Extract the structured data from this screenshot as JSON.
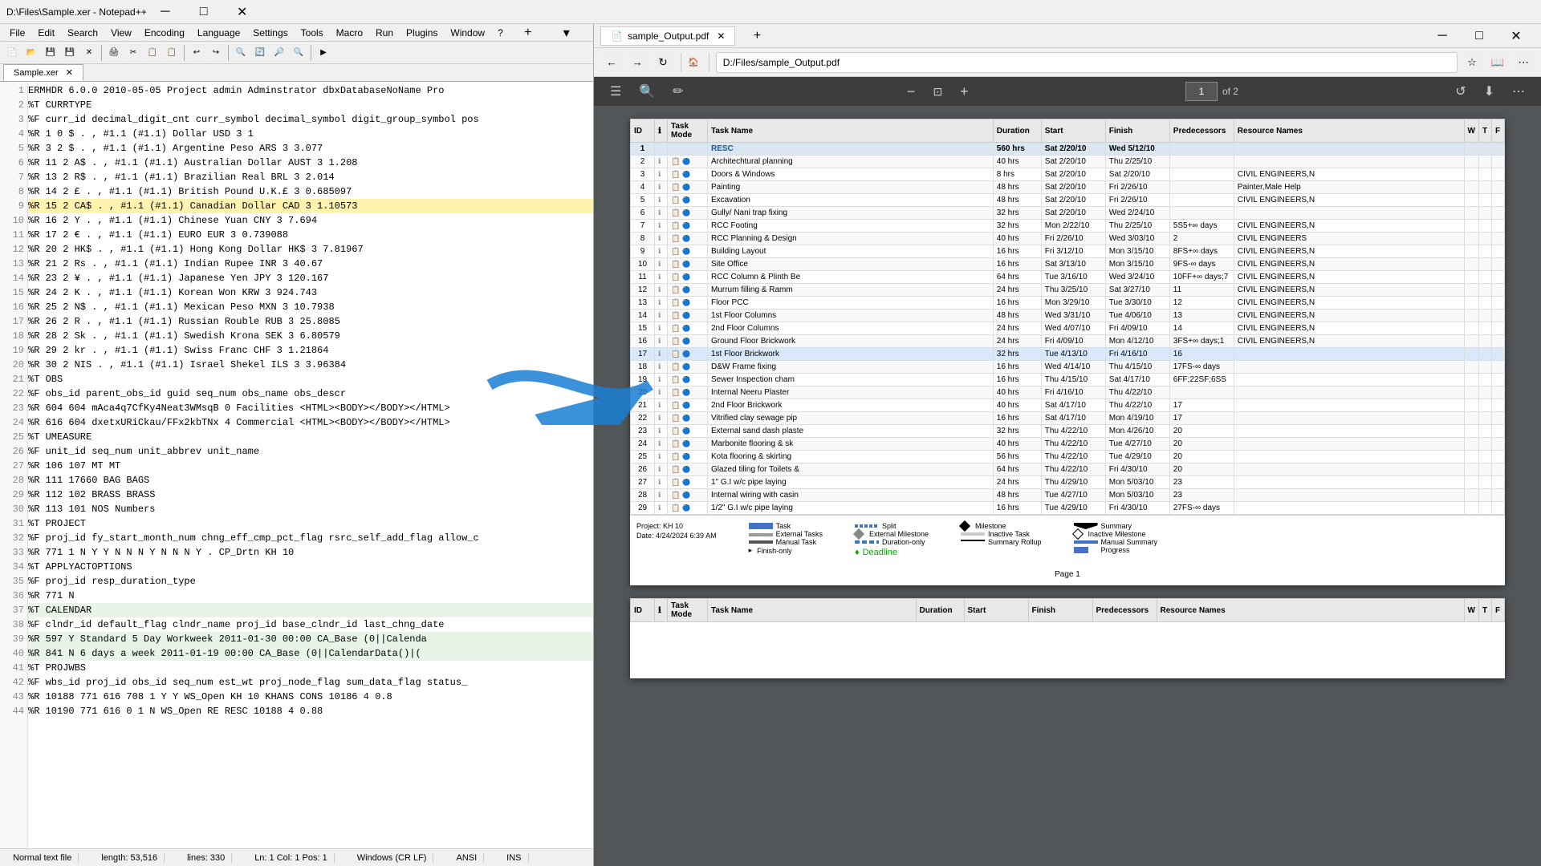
{
  "notepad": {
    "title": "D:\\Files\\Sample.xer - Notepad++",
    "filename": "Sample.xer",
    "menubar": [
      "File",
      "Edit",
      "Search",
      "View",
      "Encoding",
      "Language",
      "Settings",
      "Tools",
      "Macro",
      "Run",
      "Plugins",
      "Window",
      "?"
    ],
    "statusbar": {
      "mode": "Normal text file",
      "length": "length: 53,516",
      "lines": "lines: 330",
      "position": "Ln: 1   Col: 1   Pos: 1",
      "endings": "Windows (CR LF)",
      "encoding": "ANSI",
      "ins": "INS"
    },
    "lines": [
      {
        "num": 1,
        "text": "ERMHDR   6.0.0    2010-05-05  Project admin   Adminstrator    dbxDatabaseNoName    Pro"
      },
      {
        "num": 2,
        "text": "%T  CURRTYPE"
      },
      {
        "num": 3,
        "text": "%F  curr_id decimal_digit_cnt    curr_symbol decimal_symbol  digit_group_symbol  pos"
      },
      {
        "num": 4,
        "text": "%R  1   0   $   .   ,   #1.1    (#1.1)  Dollar  USD 3   1"
      },
      {
        "num": 5,
        "text": "%R  3   2   $   .   ,   #1.1    (#1.1)  Argentine Peso  ARS 3   3.077"
      },
      {
        "num": 6,
        "text": "%R  11  2   A$  .   ,   #1.1    (#1.1)  Australian Dollar   AUST    3   1.208"
      },
      {
        "num": 7,
        "text": "%R  13  2   R$  .   ,   #1.1    (#1.1)  Brazilian Real  BRL 3   2.014"
      },
      {
        "num": 8,
        "text": "%R  14  2   £   .   ,   #1.1    (#1.1)  British Pound   U.K.£   3   0.685097"
      },
      {
        "num": 9,
        "text": "%R  15  2   CA$ .   ,   #1.1    (#1.1)  Canadian Dollar CAD 3   1.10573"
      },
      {
        "num": 10,
        "text": "%R  16  2   Y   .   ,   #1.1    (#1.1)  Chinese Yuan    CNY 3   7.694"
      },
      {
        "num": 11,
        "text": "%R  17  2   €   .   ,   #1.1    (#1.1)  EURO    EUR 3   0.739088"
      },
      {
        "num": 12,
        "text": "%R  20  2   HK$ .   ,   #1.1    (#1.1)  Hong Kong Dollar    HK$ 3   7.81967"
      },
      {
        "num": 13,
        "text": "%R  21  2   Rs  .   ,   #1.1    (#1.1)  Indian Rupee    INR 3   40.67"
      },
      {
        "num": 14,
        "text": "%R  23  2   ¥   .   ,   #1.1    (#1.1)  Japanese Yen    JPY 3   120.167"
      },
      {
        "num": 15,
        "text": "%R  24  2   K   .   ,   #1.1    (#1.1)  Korean Won  KRW 3   924.743"
      },
      {
        "num": 16,
        "text": "%R  25  2   N$  .   ,   #1.1    (#1.1)  Mexican Peso    MXN 3   10.7938"
      },
      {
        "num": 17,
        "text": "%R  26  2   R   .   ,   #1.1    (#1.1)  Russian Rouble  RUB 3   25.8085"
      },
      {
        "num": 18,
        "text": "%R  28  2   Sk  .   ,   #1.1    (#1.1)  Swedish Krona   SEK 3   6.80579"
      },
      {
        "num": 19,
        "text": "%R  29  2   kr  .   ,   #1.1    (#1.1)  Swiss Franc CHF 3   1.21864"
      },
      {
        "num": 20,
        "text": "%R  30  2   NIS .   ,   #1.1    (#1.1)  Israel Shekel   ILS 3   3.96384"
      },
      {
        "num": 21,
        "text": "%T  OBS"
      },
      {
        "num": 22,
        "text": "%F  obs_id  parent_obs_id   guid    seq_num obs_name    obs_descr"
      },
      {
        "num": 23,
        "text": "%R  604 604 mAca4q7CfKy4Neat3WMsqB  0   Facilities  <HTML><BODY></BODY></HTML>"
      },
      {
        "num": 24,
        "text": "%R  616 604 dxetxURiCkau/FFx2kbTNx  4   Commercial  <HTML><BODY></BODY></HTML>"
      },
      {
        "num": 25,
        "text": "%T  UMEASURE"
      },
      {
        "num": 26,
        "text": "%F  unit_id seq_num unit_abbrev unit_name"
      },
      {
        "num": 27,
        "text": "%R  106 107 MT  MT"
      },
      {
        "num": 28,
        "text": "%R  111 17660   BAG BAGS"
      },
      {
        "num": 29,
        "text": "%R  112 102 BRASS   BRASS"
      },
      {
        "num": 30,
        "text": "%R  113 101 NOS Numbers"
      },
      {
        "num": 31,
        "text": "%T  PROJECT"
      },
      {
        "num": 32,
        "text": "%F  proj_id fy_start_month_num   chng_eff_cmp_pct_flag   rsrc_self_add_flag  allow_c"
      },
      {
        "num": 33,
        "text": "%R  771 1   N   Y   Y   N   N   N   Y   N   N   N   Y   .   CP_Drtn KH 10"
      },
      {
        "num": 34,
        "text": "%T  APPLYACTOPTIONS"
      },
      {
        "num": 35,
        "text": "%F  proj_id resp_duration_type"
      },
      {
        "num": 36,
        "text": "%R  771 N"
      },
      {
        "num": 37,
        "text": "%T  CALENDAR"
      },
      {
        "num": 38,
        "text": "%F  clndr_id    default_flag    clndr_name  proj_id base_clndr_id    last_chng_date"
      },
      {
        "num": 39,
        "text": "%R  597 Y   Standard 5 Day Workweek    2011-01-30 00:00    CA_Base (0||Calenda"
      },
      {
        "num": 40,
        "text": "%R  841 N   6 days a week   2011-01-19 00:00    CA_Base (0||CalendarData()|("
      },
      {
        "num": 41,
        "text": "%T  PROJWBS"
      },
      {
        "num": 42,
        "text": "%F  wbs_id  proj_id obs_id  seq_num est_wt  proj_node_flag  sum_data_flag   status_"
      },
      {
        "num": 43,
        "text": "%R  10188   771 616 708 1   Y   Y   WS_Open KH 10   KHANS CONS  10186   4   0.8"
      },
      {
        "num": 44,
        "text": "%R  10190   771 616 0   1   N   WS_Open RE  RESC    10188   4   0.88"
      }
    ]
  },
  "pdf_viewer": {
    "title": "sample_Output.pdf",
    "url": "D:/Files/sample_Output.pdf",
    "current_page": "1",
    "total_pages": "2",
    "toolbar": {
      "back": "←",
      "forward": "→",
      "refresh": "↻",
      "zoom_out": "−",
      "zoom_in": "+",
      "fit": "⊡",
      "more": "⋯"
    },
    "gantt": {
      "columns": [
        "ID",
        "",
        "Task Mode",
        "Task Name",
        "Duration",
        "Start",
        "Finish",
        "Predecessors",
        "Resource Names",
        "W",
        "T",
        "F"
      ],
      "rows": [
        {
          "id": 1,
          "mode": "",
          "name": "RESC",
          "duration": "560 hrs",
          "start": "Sat 2/20/10",
          "finish": "Wed 5/12/10",
          "pred": "",
          "resource": "",
          "bold": true
        },
        {
          "id": 2,
          "mode": "📋",
          "name": "Architechtural planning",
          "duration": "40 hrs",
          "start": "Sat 2/20/10",
          "finish": "Thu 2/25/10",
          "pred": "",
          "resource": ""
        },
        {
          "id": 3,
          "mode": "📋",
          "name": "Doors & Windows",
          "duration": "8 hrs",
          "start": "Sat 2/20/10",
          "finish": "Sat 2/20/10",
          "pred": "",
          "resource": "CIVIL ENGINEERS,N"
        },
        {
          "id": 4,
          "mode": "📋",
          "name": "Painting",
          "duration": "48 hrs",
          "start": "Sat 2/20/10",
          "finish": "Fri 2/26/10",
          "pred": "",
          "resource": "Painter,Male Help"
        },
        {
          "id": 5,
          "mode": "📋",
          "name": "Excavation",
          "duration": "48 hrs",
          "start": "Sat 2/20/10",
          "finish": "Fri 2/26/10",
          "pred": "",
          "resource": "CIVIL ENGINEERS,N"
        },
        {
          "id": 6,
          "mode": "📋",
          "name": "Gully/ Nani trap fixing",
          "duration": "32 hrs",
          "start": "Sat 2/20/10",
          "finish": "Wed 2/24/10",
          "pred": "",
          "resource": ""
        },
        {
          "id": 7,
          "mode": "📋",
          "name": "RCC Footing",
          "duration": "32 hrs",
          "start": "Mon 2/22/10",
          "finish": "Thu 2/25/10",
          "pred": "5S5+∞ days",
          "resource": "CIVIL ENGINEERS,N"
        },
        {
          "id": 8,
          "mode": "📋",
          "name": "RCC Planning & Design",
          "duration": "40 hrs",
          "start": "Fri 2/26/10",
          "finish": "Wed 3/03/10",
          "pred": "2",
          "resource": "CIVIL ENGINEERS"
        },
        {
          "id": 9,
          "mode": "📋",
          "name": "Building Layout",
          "duration": "16 hrs",
          "start": "Fri 3/12/10",
          "finish": "Mon 3/15/10",
          "pred": "8FS+∞ days",
          "resource": "CIVIL ENGINEERS,N"
        },
        {
          "id": 10,
          "mode": "📋",
          "name": "Site Office",
          "duration": "16 hrs",
          "start": "Sat 3/13/10",
          "finish": "Mon 3/15/10",
          "pred": "9FS-∞ days",
          "resource": "CIVIL ENGINEERS,N"
        },
        {
          "id": 11,
          "mode": "📋",
          "name": "RCC Column & Plinth Be",
          "duration": "64 hrs",
          "start": "Tue 3/16/10",
          "finish": "Wed 3/24/10",
          "pred": "10FF+∞ days;7",
          "resource": "CIVIL ENGINEERS,N"
        },
        {
          "id": 12,
          "mode": "📋",
          "name": "Murrum filling & Ramm",
          "duration": "24 hrs",
          "start": "Thu 3/25/10",
          "finish": "Sat 3/27/10",
          "pred": "11",
          "resource": "CIVIL ENGINEERS,N"
        },
        {
          "id": 13,
          "mode": "📋",
          "name": "Floor PCC",
          "duration": "16 hrs",
          "start": "Mon 3/29/10",
          "finish": "Tue 3/30/10",
          "pred": "12",
          "resource": "CIVIL ENGINEERS,N"
        },
        {
          "id": 14,
          "mode": "📋",
          "name": "1st Floor Columns",
          "duration": "48 hrs",
          "start": "Wed 3/31/10",
          "finish": "Tue 4/06/10",
          "pred": "13",
          "resource": "CIVIL ENGINEERS,N"
        },
        {
          "id": 15,
          "mode": "📋",
          "name": "2nd Floor Columns",
          "duration": "24 hrs",
          "start": "Wed 4/07/10",
          "finish": "Fri 4/09/10",
          "pred": "14",
          "resource": "CIVIL ENGINEERS,N"
        },
        {
          "id": 16,
          "mode": "📋",
          "name": "Ground Floor Brickwork",
          "duration": "24 hrs",
          "start": "Fri 4/09/10",
          "finish": "Mon 4/12/10",
          "pred": "3FS+∞ days;1",
          "resource": "CIVIL ENGINEERS,N"
        },
        {
          "id": 17,
          "mode": "📋",
          "name": "1st Floor Brickwork",
          "duration": "32 hrs",
          "start": "Tue 4/13/10",
          "finish": "Fri 4/16/10",
          "pred": "16",
          "resource": ""
        },
        {
          "id": 18,
          "mode": "📋",
          "name": "D&W Frame fixing",
          "duration": "16 hrs",
          "start": "Wed 4/14/10",
          "finish": "Thu 4/15/10",
          "pred": "17FS-∞ days",
          "resource": ""
        },
        {
          "id": 19,
          "mode": "📋",
          "name": "Sewer Inspection cham",
          "duration": "16 hrs",
          "start": "Thu 4/15/10",
          "finish": "Sat 4/17/10",
          "pred": "6FF;22SF;6SS",
          "resource": ""
        },
        {
          "id": 20,
          "mode": "📋",
          "name": "Internal Neeru Plaster",
          "duration": "40 hrs",
          "start": "Fri 4/16/10",
          "finish": "Thu 4/22/10",
          "pred": "",
          "resource": ""
        },
        {
          "id": 21,
          "mode": "📋",
          "name": "2nd Floor Brickwork",
          "duration": "40 hrs",
          "start": "Sat 4/17/10",
          "finish": "Thu 4/22/10",
          "pred": "17",
          "resource": ""
        },
        {
          "id": 22,
          "mode": "📋",
          "name": "Vitrified clay sewage pip",
          "duration": "16 hrs",
          "start": "Sat 4/17/10",
          "finish": "Mon 4/19/10",
          "pred": "17",
          "resource": ""
        },
        {
          "id": 23,
          "mode": "📋",
          "name": "External sand dash plaste",
          "duration": "32 hrs",
          "start": "Thu 4/22/10",
          "finish": "Mon 4/26/10",
          "pred": "20",
          "resource": ""
        },
        {
          "id": 24,
          "mode": "📋",
          "name": "Marbonite flooring & sk",
          "duration": "40 hrs",
          "start": "Thu 4/22/10",
          "finish": "Tue 4/27/10",
          "pred": "20",
          "resource": ""
        },
        {
          "id": 25,
          "mode": "📋",
          "name": "Kota flooring & skirting",
          "duration": "56 hrs",
          "start": "Thu 4/22/10",
          "finish": "Tue 4/29/10",
          "pred": "20",
          "resource": ""
        },
        {
          "id": 26,
          "mode": "📋",
          "name": "Glazed tiling for Toilets &",
          "duration": "64 hrs",
          "start": "Thu 4/22/10",
          "finish": "Fri 4/30/10",
          "pred": "20",
          "resource": ""
        },
        {
          "id": 27,
          "mode": "📋",
          "name": "1\" G.I w/c pipe laying",
          "duration": "24 hrs",
          "start": "Thu 4/29/10",
          "finish": "Mon 5/03/10",
          "pred": "23",
          "resource": ""
        },
        {
          "id": 28,
          "mode": "📋",
          "name": "Internal wiring with casin",
          "duration": "48 hrs",
          "start": "Tue 4/27/10",
          "finish": "Mon 5/03/10",
          "pred": "23",
          "resource": ""
        },
        {
          "id": 29,
          "mode": "📋",
          "name": "1/2\" G.I w/c pipe laying",
          "duration": "16 hrs",
          "start": "Tue 4/29/10",
          "finish": "Fri 4/30/10",
          "pred": "27FS-∞ days",
          "resource": ""
        }
      ],
      "legend": {
        "project": "Project: KH 10",
        "date": "Date: 4/24/2024 6:39 AM",
        "items": [
          "Task",
          "Split",
          "Milestone",
          "Summary",
          "External Tasks",
          "External Milestone",
          "Inactive Task",
          "Inactive Milestone",
          "Manual Task",
          "Duration-only",
          "Summary Rollup",
          "Manual Summary",
          "Finish-only",
          "Progress",
          "Deadline"
        ]
      },
      "page_label": "Page 1"
    }
  },
  "arrow": {
    "description": "Blue arrow pointing from line 9 (CAD) to PDF row 17"
  }
}
